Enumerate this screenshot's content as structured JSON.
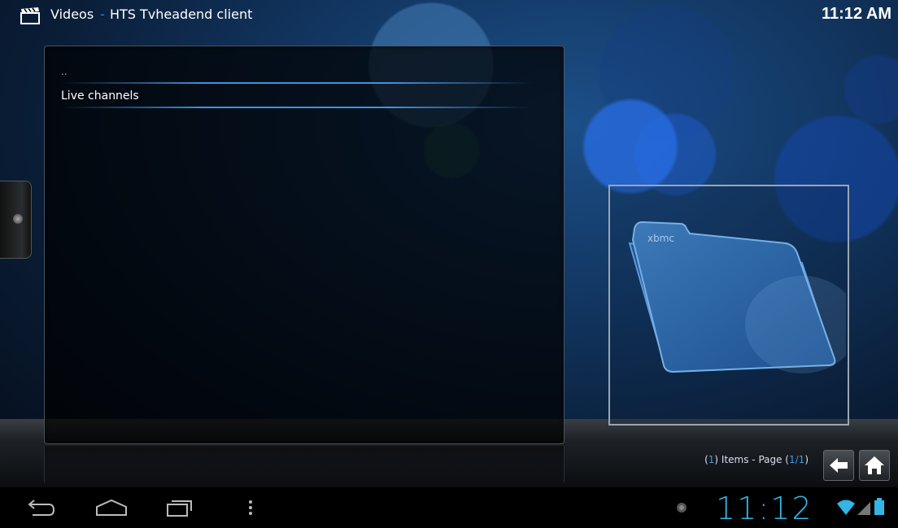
{
  "window": {
    "section": "Videos",
    "separator": "-",
    "addon": "HTS Tvheadend client",
    "clock": "11:12 AM"
  },
  "list": {
    "items": [
      {
        "label": ".."
      },
      {
        "label": "Live channels"
      }
    ]
  },
  "thumbnail": {
    "logo_text": "xbmc",
    "icon": "folder-icon"
  },
  "footer": {
    "count": "1",
    "items_text": ") Items - Page (",
    "page": "1/1",
    "close": ")"
  },
  "navigation": {
    "back_icon": "back-arrow-icon",
    "home_icon": "home-icon"
  },
  "systembar": {
    "clock": "11:12",
    "icons": [
      "back-icon",
      "home-icon",
      "recent-apps-icon",
      "menu-icon",
      "notification-icon",
      "wifi-icon",
      "signal-icon",
      "battery-icon"
    ]
  },
  "colors": {
    "accent": "#33b5e5",
    "highlight": "#3a9be8"
  }
}
